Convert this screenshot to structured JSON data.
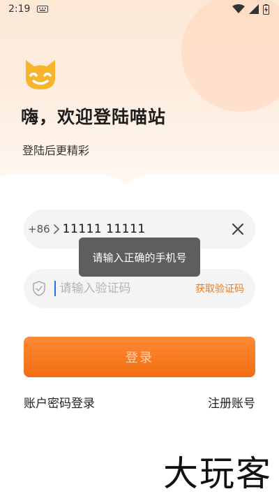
{
  "status_bar": {
    "time": "2:19"
  },
  "header": {
    "title": "嗨，欢迎登陆喵站",
    "subtitle": "登陆后更精彩"
  },
  "phone_field": {
    "country_code": "+86",
    "value": "11111 11111"
  },
  "code_field": {
    "placeholder": "请输入验证码",
    "get_code_label": "获取验证码"
  },
  "toast": {
    "message": "请输入正确的手机号"
  },
  "login_button": {
    "label": "登录"
  },
  "links": {
    "password_login": "账户密码登录",
    "register": "注册账号"
  },
  "watermark": {
    "text": "大玩客"
  },
  "colors": {
    "accent": "#f26d12",
    "get_code": "#f07c22",
    "logo_yellow": "#f7b52b"
  },
  "icons": {
    "logo": "cat-logo-icon",
    "chevron": "chevron-right-icon",
    "clear": "close-icon",
    "shield": "shield-icon"
  }
}
